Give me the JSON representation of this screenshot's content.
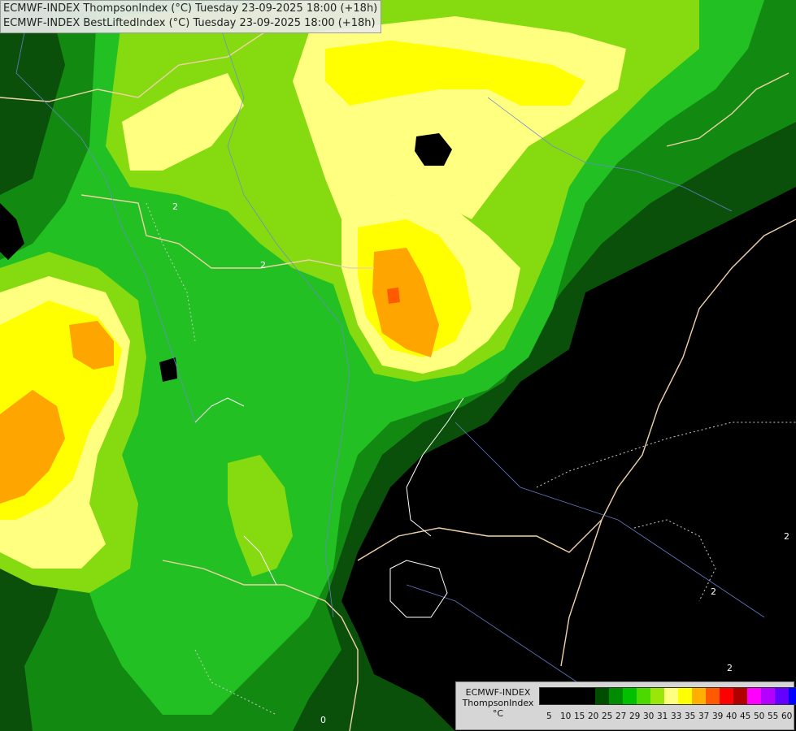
{
  "header": {
    "line1": "ECMWF-INDEX ThompsonIndex (°C) Tuesday 23-09-2025 18:00 (+18h)",
    "line2": "ECMWF-INDEX BestLiftedIndex (°C) Tuesday 23-09-2025 18:00 (+18h)"
  },
  "legend": {
    "line1": "ECMWF-INDEX",
    "line2": "ThompsonIndex",
    "line3": "°C",
    "ticks": [
      "5",
      "10",
      "15",
      "20",
      "25",
      "27",
      "29",
      "30",
      "31",
      "33",
      "35",
      "37",
      "39",
      "40",
      "45",
      "50",
      "55",
      "60"
    ],
    "colors": [
      "#000000",
      "#000000",
      "#000000",
      "#000000",
      "#004d00",
      "#008c00",
      "#00c000",
      "#4cd900",
      "#9be60a",
      "#ffff80",
      "#ffff00",
      "#ffb000",
      "#ff5a00",
      "#ff0000",
      "#b00000",
      "#ff00ff",
      "#b400ff",
      "#6400ff",
      "#0000ff"
    ]
  },
  "map": {
    "background_color": "#000000",
    "contour_labels": [
      "2",
      "2",
      "2",
      "2",
      "0",
      "2"
    ]
  }
}
